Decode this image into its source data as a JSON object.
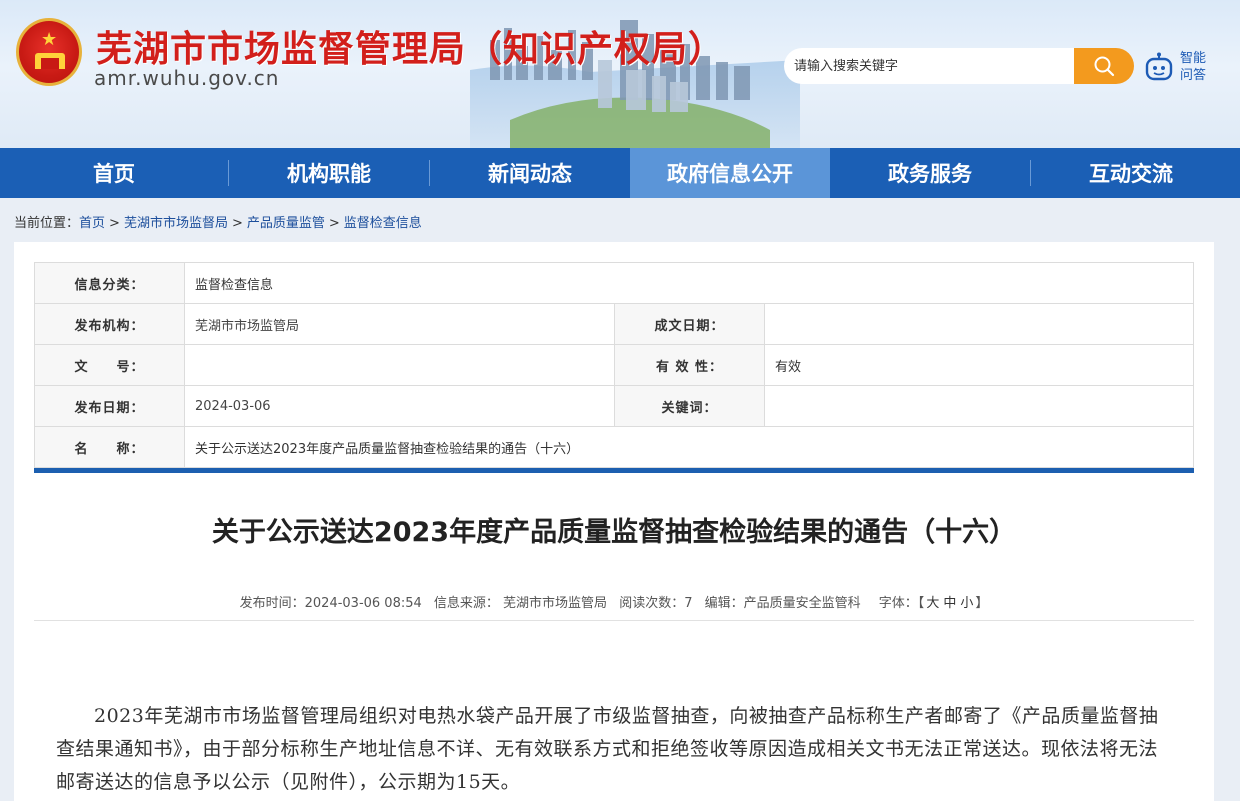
{
  "header": {
    "site_title": "芜湖市市场监督管理局（知识产权局）",
    "domain": "amr.wuhu.gov.cn",
    "search_placeholder": "请输入搜索关键字",
    "ai_label": "智能问答",
    "emblem_icon": "national-emblem-icon",
    "search_icon": "magnifier-icon",
    "robot_icon": "robot-icon"
  },
  "nav": {
    "items": [
      {
        "label": "首页"
      },
      {
        "label": "机构职能"
      },
      {
        "label": "新闻动态"
      },
      {
        "label": "政府信息公开",
        "active": true
      },
      {
        "label": "政务服务"
      },
      {
        "label": "互动交流"
      }
    ]
  },
  "breadcrumb": {
    "prefix": "当前位置：",
    "items": [
      "首页",
      "芜湖市市场监督局",
      "产品质量监管",
      "监督检查信息"
    ],
    "separator": ">"
  },
  "info_table": {
    "category_label": "信息分类：",
    "category_value": "监督检查信息",
    "org_label": "发布机构：",
    "org_value": "芜湖市市场监管局",
    "doc_date_label": "成文日期：",
    "doc_date_value": "",
    "doc_no_label": "文　　号：",
    "doc_no_value": "",
    "validity_label": "有 效 性：",
    "validity_value": "有效",
    "pub_date_label": "发布日期：",
    "pub_date_value": "2024-03-06",
    "keywords_label": "关键词：",
    "keywords_value": "",
    "name_label": "名　　称：",
    "name_value": "关于公示送达2023年度产品质量监督抽查检验结果的通告（十六）"
  },
  "article": {
    "title": "关于公示送达2023年度产品质量监督抽查检验结果的通告（十六）",
    "meta": {
      "publish_time": "发布时间：2024-03-06 08:54",
      "source": "信息来源： 芜湖市市场监管局",
      "reads": "阅读次数：7",
      "editor": "编辑：产品质量安全监管科",
      "font_label": "字体：",
      "font_open": "【",
      "font_large": "大",
      "font_medium": "中",
      "font_small": "小",
      "font_close": "】"
    },
    "body": "2023年芜湖市市场监督管理局组织对电热水袋产品开展了市级监督抽查，向被抽查产品标称生产者邮寄了《产品质量监督抽查结果通知书》，由于部分标称生产地址信息不详、无有效联系方式和拒绝签收等原因造成相关文书无法正常送达。现依法将无法邮寄送达的信息予以公示（见附件），公示期为15天。"
  },
  "colors": {
    "nav_bg": "#1b5fb5",
    "nav_active": "#5b95d8",
    "title_red": "#d21f1b",
    "search_orange": "#f39a1e"
  }
}
